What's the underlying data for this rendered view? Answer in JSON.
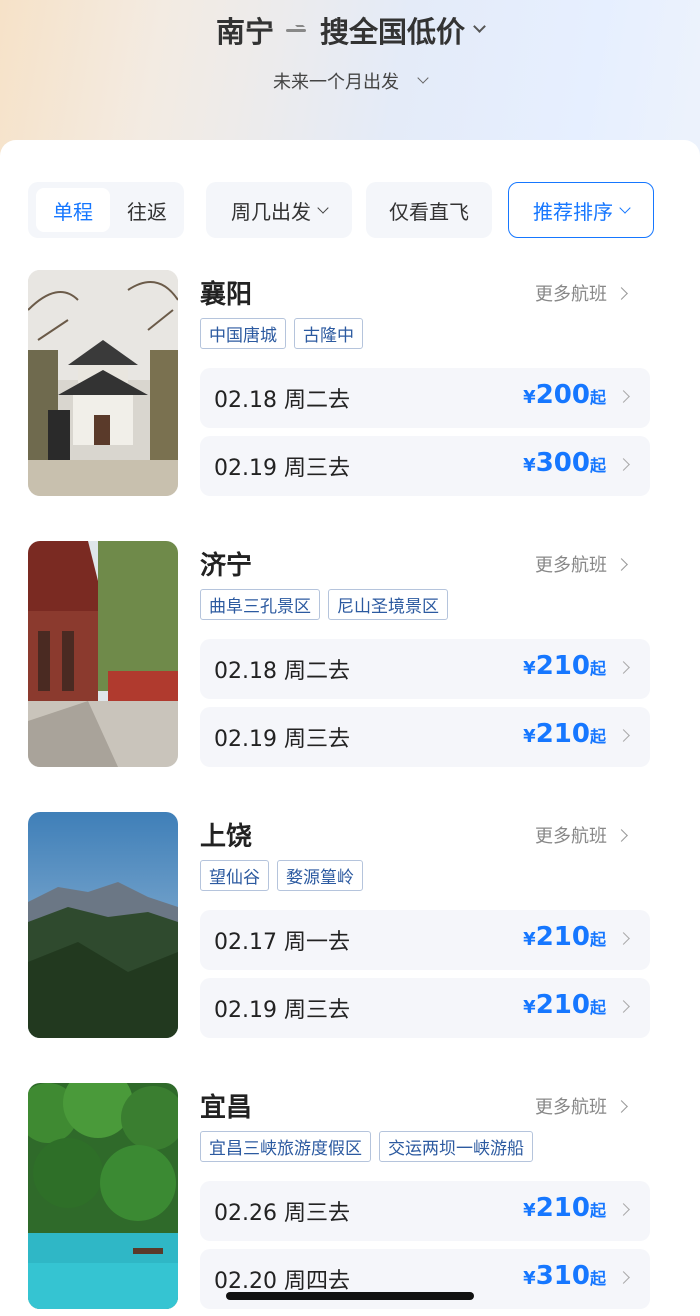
{
  "header": {
    "origin": "南宁",
    "destination": "搜全国低价",
    "date_filter": "未来一个月出发"
  },
  "filters": {
    "one_way": "单程",
    "round_trip": "往返",
    "weekday": "周几出发",
    "direct_only": "仅看直飞",
    "sort": "推荐排序"
  },
  "more_label": "更多航班",
  "currency": "¥",
  "price_suffix": "起",
  "destinations": [
    {
      "city": "襄阳",
      "tags": [
        "中国唐城",
        "古隆中"
      ],
      "flights": [
        {
          "date": "02.18  周二去",
          "price": "200"
        },
        {
          "date": "02.19  周三去",
          "price": "300"
        }
      ]
    },
    {
      "city": "济宁",
      "tags": [
        "曲阜三孔景区",
        "尼山圣境景区"
      ],
      "flights": [
        {
          "date": "02.18  周二去",
          "price": "210"
        },
        {
          "date": "02.19  周三去",
          "price": "210"
        }
      ]
    },
    {
      "city": "上饶",
      "tags": [
        "望仙谷",
        "婺源篁岭"
      ],
      "flights": [
        {
          "date": "02.17  周一去",
          "price": "210"
        },
        {
          "date": "02.19  周三去",
          "price": "210"
        }
      ]
    },
    {
      "city": "宜昌",
      "tags": [
        "宜昌三峡旅游度假区",
        "交运两坝一峡游船"
      ],
      "flights": [
        {
          "date": "02.26  周三去",
          "price": "210"
        },
        {
          "date": "02.20  周四去",
          "price": "310"
        }
      ]
    }
  ],
  "colors": {
    "accent": "#1677ff",
    "tag_text": "#2c5aa0",
    "row_bg": "#f5f6fa"
  }
}
